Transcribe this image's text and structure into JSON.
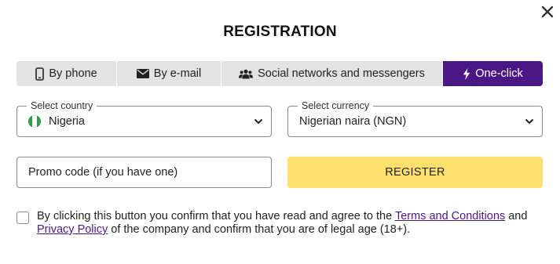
{
  "dialog": {
    "title": "REGISTRATION"
  },
  "tabs": [
    {
      "label": "By phone",
      "icon": "phone-icon",
      "active": false
    },
    {
      "label": "By e-mail",
      "icon": "envelope-icon",
      "active": false
    },
    {
      "label": "Social networks and messengers",
      "icon": "users-icon",
      "active": false
    },
    {
      "label": "One-click",
      "icon": "lightning-icon",
      "active": true
    }
  ],
  "country": {
    "label": "Select country",
    "value": "Nigeria",
    "flag_colors": [
      "#2e9e4a",
      "#ffffff",
      "#2e9e4a"
    ]
  },
  "currency": {
    "label": "Select currency",
    "value": "Nigerian naira (NGN)"
  },
  "promo": {
    "placeholder": "Promo code (if you have one)"
  },
  "register": {
    "label": "REGISTER"
  },
  "agreement": {
    "text_1": "By clicking this button you confirm that you have read and agree to the ",
    "terms_link": "Terms and Conditions",
    "text_2": " and ",
    "privacy_link": "Privacy Policy",
    "text_3": " of the company and confirm that you are of legal age (18+)."
  },
  "colors": {
    "accent": "#4b1784",
    "button": "#ffe06c",
    "tab_bg": "#e3e3e3"
  }
}
